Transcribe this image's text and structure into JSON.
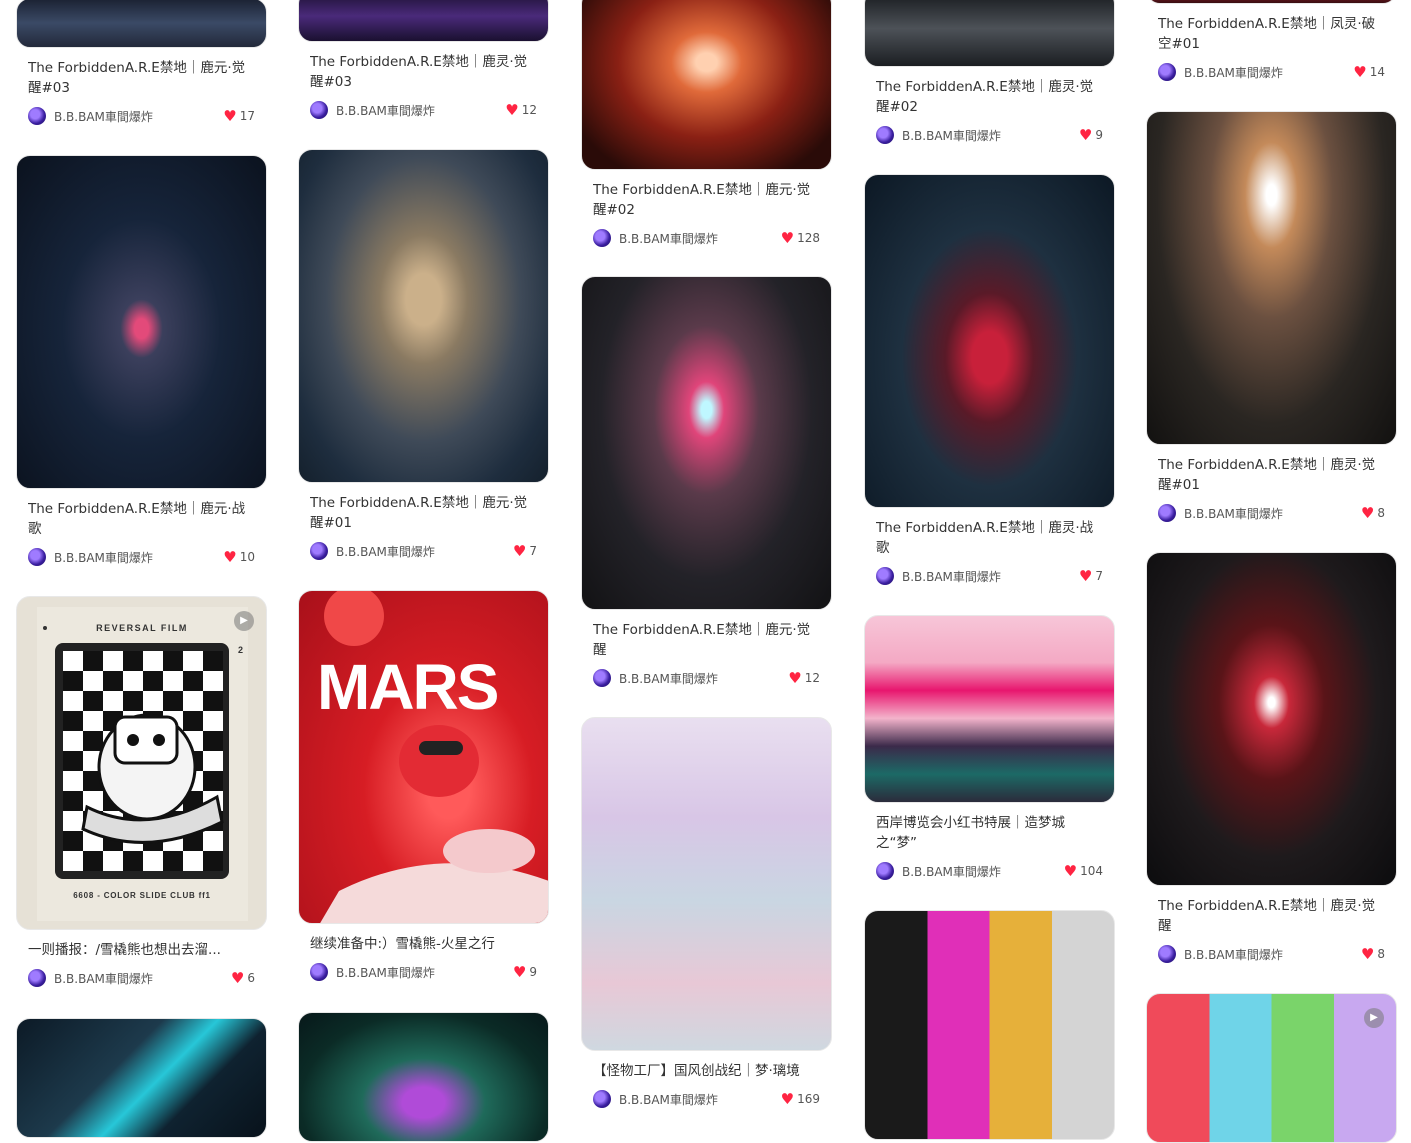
{
  "author": "B.B.BAM車間爆炸",
  "colors": {
    "heart": "#ff2442"
  },
  "icons": {
    "like": "heart-icon",
    "play": "play-icon",
    "avatar": "avatar-image"
  },
  "cards": [
    {
      "title": "The ForbiddenA.R.E禁地｜鹿元·觉醒#03",
      "likes": "17"
    },
    {
      "title": "The ForbiddenA.R.E禁地｜鹿元·战歌",
      "likes": "10"
    },
    {
      "title": "一则播报：/雪橇熊也想出去溜...",
      "likes": "6"
    },
    {
      "title": "The ForbiddenA.R.E禁地｜鹿灵·觉醒#03",
      "likes": "12"
    },
    {
      "title": "The ForbiddenA.R.E禁地｜鹿元·觉醒#01",
      "likes": "7"
    },
    {
      "title": "继续准备中:）雪橇熊-火星之行",
      "likes": "9"
    },
    {
      "title": "The ForbiddenA.R.E禁地｜鹿元·觉醒#02",
      "likes": "128"
    },
    {
      "title": "The ForbiddenA.R.E禁地｜鹿元·觉醒",
      "likes": "12"
    },
    {
      "title": "【怪物工厂】国风创战纪｜梦·璃境",
      "likes": "169"
    },
    {
      "title": "The ForbiddenA.R.E禁地｜鹿灵·觉醒#02",
      "likes": "9"
    },
    {
      "title": "The ForbiddenA.R.E禁地｜鹿灵·战歌",
      "likes": "7"
    },
    {
      "title": "西岸博览会小红书特展｜造梦城之“梦”",
      "likes": "104"
    },
    {
      "title": "The ForbiddenA.R.E禁地｜凤灵·破空#01",
      "likes": "14"
    },
    {
      "title": "The ForbiddenA.R.E禁地｜鹿灵·觉醒#01",
      "likes": "8"
    },
    {
      "title": "The ForbiddenA.R.E禁地｜鹿灵·觉醒",
      "likes": "8"
    }
  ],
  "artwork_text": {
    "reversal_film": "REVERSAL FILM",
    "film_number": "2",
    "film_footer": "6608 - COLOR SLIDE CLUB  ff1",
    "mars": "MARS"
  }
}
